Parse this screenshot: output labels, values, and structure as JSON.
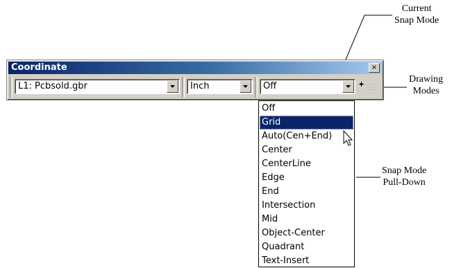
{
  "callouts": {
    "current_snap_mode": [
      "Current",
      "Snap Mode"
    ],
    "drawing_modes": [
      "Drawing",
      "Modes"
    ],
    "snap_mode_pulldown": [
      "Snap Mode",
      "Pull-Down"
    ]
  },
  "window": {
    "title": "Coordinate",
    "close_glyph": "×"
  },
  "layer_combo": {
    "value": "L1: Pcbsold.gbr"
  },
  "units_combo": {
    "value": "Inch"
  },
  "snap_combo": {
    "value": "Off"
  },
  "snap_menu": {
    "selected": "Grid",
    "items": [
      "Off",
      "Grid",
      "Auto(Cen+End)",
      "Center",
      "CenterLine",
      "Edge",
      "End",
      "Intersection",
      "Mid",
      "Object-Center",
      "Quadrant",
      "Text-Insert"
    ]
  },
  "icons": [
    "close-icon",
    "dropdown-arrow-icon",
    "drawing-modes-icon",
    "mouse-pointer-icon"
  ],
  "colors": {
    "titlebar": "#0a246a",
    "selection": "#0a246a",
    "face": "#d4d0c8"
  }
}
